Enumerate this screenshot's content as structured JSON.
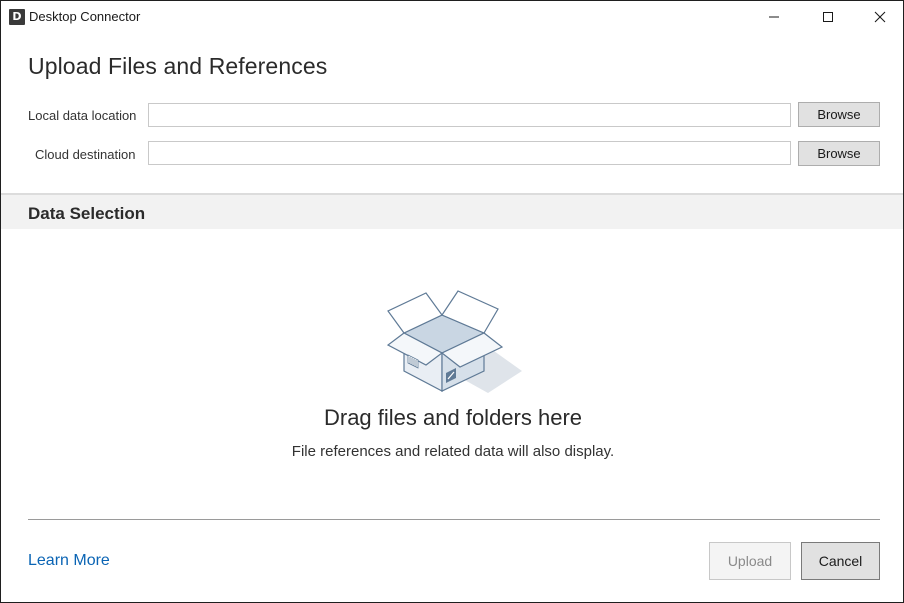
{
  "window": {
    "app_icon_letter": "D",
    "title": "Desktop Connector"
  },
  "header": {
    "title": "Upload Files and References"
  },
  "form": {
    "local": {
      "label": "Local data location",
      "value": "",
      "browse_label": "Browse"
    },
    "cloud": {
      "label": "Cloud destination",
      "value": "",
      "browse_label": "Browse"
    }
  },
  "data_selection": {
    "title": "Data Selection",
    "drop_title": "Drag files and folders here",
    "drop_subtitle": "File references and related data will also display."
  },
  "footer": {
    "learn_more": "Learn More",
    "upload_label": "Upload",
    "cancel_label": "Cancel",
    "upload_enabled": false
  },
  "colors": {
    "link": "#0a64b4",
    "section_band": "#f2f2f2",
    "button_face": "#e1e1e1"
  },
  "icons": {
    "app": "desktop-connector-icon",
    "minimize": "minimize-icon",
    "maximize": "maximize-icon",
    "close": "close-icon",
    "illustration": "open-box-icon"
  }
}
